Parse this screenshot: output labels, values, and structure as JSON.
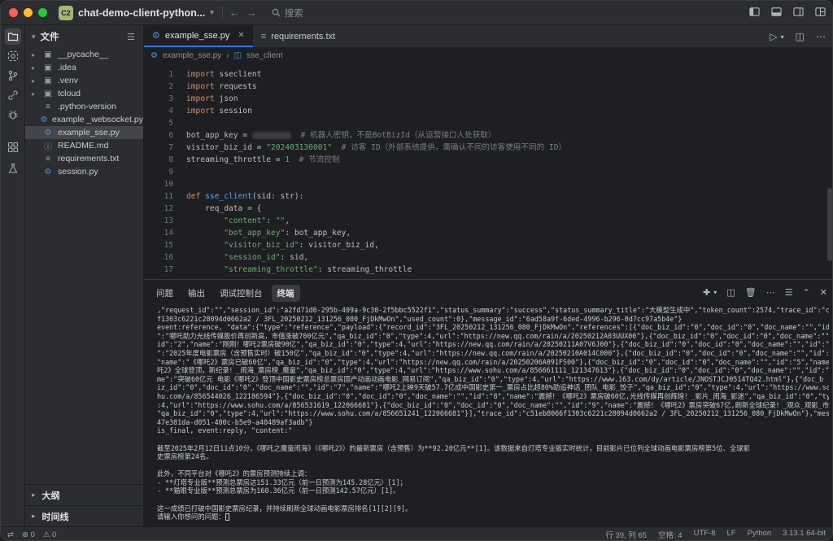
{
  "titlebar": {
    "project_badge": "C2",
    "project_name": "chat-demo-client-python...",
    "search_placeholder": "搜索"
  },
  "explorer": {
    "title": "文件",
    "items": [
      {
        "label": "__pycache__",
        "kind": "folder",
        "icon": "folder-icon"
      },
      {
        "label": ".idea",
        "kind": "folder",
        "icon": "folder-icon"
      },
      {
        "label": ".venv",
        "kind": "folder",
        "icon": "folder-icon"
      },
      {
        "label": "tcloud",
        "kind": "folder",
        "icon": "folder-icon"
      },
      {
        "label": ".python-version",
        "kind": "file",
        "icon": "text-file-icon"
      },
      {
        "label": "example _websocket.py",
        "kind": "file",
        "icon": "python-icon"
      },
      {
        "label": "example_sse.py",
        "kind": "file",
        "icon": "python-icon",
        "selected": true
      },
      {
        "label": "README.md",
        "kind": "file",
        "icon": "info-icon"
      },
      {
        "label": "requirements.txt",
        "kind": "file",
        "icon": "text-file-icon"
      },
      {
        "label": "session.py",
        "kind": "file",
        "icon": "python-icon"
      }
    ],
    "outline": "大纲",
    "timeline": "时间线"
  },
  "tabs": [
    {
      "label": "example_sse.py",
      "active": true
    },
    {
      "label": "requirements.txt",
      "active": false
    }
  ],
  "breadcrumb": {
    "file": "example_sse.py",
    "symbol": "sse_client"
  },
  "code": {
    "line_numbers": [
      "1",
      "2",
      "3",
      "4",
      "5",
      "6",
      "7",
      "8",
      "9",
      "10",
      "11",
      "12",
      "13",
      "14",
      "15",
      "16",
      "17"
    ],
    "l1": [
      "import",
      " sseclient"
    ],
    "l2": [
      "import",
      " requests"
    ],
    "l3": [
      "import",
      " json"
    ],
    "l4": [
      "import",
      " session"
    ],
    "l6": [
      "bot_app_key = ",
      "# 机器人密钥，不是BotBizId（从运营接口人处获取）"
    ],
    "l7": [
      "visitor_biz_id = ",
      "\"202403130001\"",
      "# 访客 ID（外部系统提供，需确认不同的访客使用不同的 ID）"
    ],
    "l8": [
      "streaming_throttle = ",
      "1",
      "# 节流控制"
    ],
    "l11": [
      "def",
      " sse_client",
      "(sid: str):"
    ],
    "l12": [
      "    req_data = {"
    ],
    "l13": [
      "        ",
      "\"content\"",
      ": ",
      "\"\"",
      ","
    ],
    "l14": [
      "        ",
      "\"bot_app_key\"",
      ": bot_app_key,"
    ],
    "l15": [
      "        ",
      "\"visitor_biz_id\"",
      ": visitor_biz_id,"
    ],
    "l16": [
      "        ",
      "\"session_id\"",
      ": sid,"
    ],
    "l17": [
      "        ",
      "\"streaming_throttle\"",
      ": streaming_throttle"
    ]
  },
  "panel": {
    "tabs": [
      "问题",
      "输出",
      "调试控制台",
      "终端"
    ],
    "active_tab": "终端"
  },
  "terminal": {
    "lines": [
      ",\"request_id\":\"\",\"session_id\":\"a2fd71d6-295b-409a-9c30-2f5bbc5522f1\",\"status_summary\":\"success\",\"status_summary_title\":\"大模型生成中\",\"token_count\":2574,\"trace_id\":\"c51eb8066",
      "f1303c6221c28094d0662a2 / 3FL_20250212_131256_080_FjDkMwOn\",\"used_count\":0},\"message_id\":\"6ad58a9f-6ded-4996-b296-0d7cc97a5b4e\"}",
      "event:reference, \"data\":{\"type\":\"reference\",\"payload\":{\"record_id\":\"3FL_20250212_131256_080_FjDkMwOn\",\"references\":[{\"doc_biz_id\":\"0\",\"doc_id\":\"0\",\"doc_name\":\"\",\"id\":\"1\",\"name",
      "\":\"哪吒助力光线传媒股价再创新高，市值涨破700亿元\",\"qa_biz_id\":\"0\",\"type\":4,\"url\":\"https://new.qq.com/rain/a/20250212A03UUX00\"},{\"doc_biz_id\":\"0\",\"doc_id\":\"0\",\"doc_name\":\"\",\"",
      "id\":\"2\",\"name\":\"刚刚！哪吒2票房破90亿\",\"qa_biz_id\":\"0\",\"type\":4,\"url\":\"https://new.qq.com/rain/a/20250211A07V6J00\"},{\"doc_biz_id\":\"0\",\"doc_id\":\"0\",\"doc_name\":\"\",\"id\":\"3\",\"name",
      "\":\"2025年度电影票房（含预售实时）破150亿\",\"qa_biz_id\":\"0\",\"type\":4,\"url\":\"https://new.qq.com/rain/a/20250210A014C000\"},{\"doc_biz_id\":\"0\",\"doc_id\":\"0\",\"doc_name\":\"\",\"id\":\"4\",",
      "\"name\":\"《哪吒2》票房已破60亿\",\"qa_biz_id\":\"0\",\"type\":4,\"url\":\"https://new.qq.com/rain/a/20250206A091FS00\"},{\"doc_biz_id\":\"0\",\"doc_id\":\"0\",\"doc_name\":\"\",\"id\":\"5\",\"name\":\"《哪",
      "吒2》全球登顶，新纪录！_闹海_票房榜_魔童\",\"qa_biz_id\":\"0\",\"type\":4,\"url\":\"https://www.sohu.com/a/856661111_121347613\"},{\"doc_biz_id\":\"0\",\"doc_id\":\"0\",\"doc_name\":\"\",\"id\":\"6\",\"na",
      "me\":\"突破60亿元 电影《哪吒2》登顶中国影史票房榜总票房国产动画动画电影_网易订阅\",\"qa_biz_id\":\"0\",\"type\":4,\"url\":\"https://www.163.com/dy/article/JNOSTJCJ0514TQ42.html\"},{\"doc_b",
      "iz_id\":\"0\",\"doc_id\":\"0\",\"doc_name\":\"\",\"id\":\"7\",\"name\":\"哪吒2上映9天破57.7亿成中国影史第一_票房占比超80%助追神话_团队_电影_饺子\",\"qa_biz_id\":\"0\",\"type\":4,\"url\":\"https://www.so",
      "hu.com/a/856544026_122186594\"},{\"doc_biz_id\":\"0\",\"doc_id\":\"0\",\"doc_name\":\"\",\"id\":\"8\",\"name\":\"震撼！《哪吒2》票房破60亿,光线传媒再创辉煌！_影片_闹海_影迷\",\"qa_biz_id\":\"0\",\"type\"",
      ":4,\"url\":\"https://www.sohu.com/a/856531619_122066681\"},{\"doc_biz_id\":\"0\",\"doc_id\":\"0\",\"doc_name\":\"\",\"id\":\"9\",\"name\":\"震撼！《哪吒2》票房突破67亿,刷新全球纪录！_观众_观影_市场\",",
      "\"qa_biz_id\":\"0\",\"type\":4,\"url\":\"https://www.sohu.com/a/856651241_122066681\"}],\"trace_id\":\"c51eb8066f1303c6221c28094d0662a2 / 3FL_20250212_131256_080_FjDkMwOn\"},\"message_id\":\"",
      "47e381da-d051-400c-b5e9-a40489af3adb\"}",
      "is_final, event:reply, \"content:\"",
      "",
      "截至2025年2月12日11点10分，《哪吒之魔童闹海》（《哪吒2》）的最新票房（含预售）为**92.20亿元**[1]。该数据来自灯塔专业版实时统计，目前影片已位列全球动画电影票房榜第5位、全球影",
      "史票房榜第24名。",
      "",
      "此外，不同平台对《哪吒2》的票房预测持续上调：",
      "- **灯塔专业版**预测总票房达151.33亿元（前一日预测为145.28亿元）[1]；",
      "- **猫眼专业版**预测总票房为160.36亿元（前一日预测142.57亿元）[1]。",
      "",
      "这一成绩已打破中国影史票房纪录，并持续刷新全球动画电影票房排名[1][2][9]。",
      "请输入你想问的问题："
    ]
  },
  "statusbar": {
    "position": "行 39, 列 65",
    "indent": "空格: 4",
    "encoding": "UTF-8",
    "eol": "LF",
    "language": "Python",
    "interpreter": "3.13.1 64-bit"
  },
  "colors": {
    "background": "#1e1f22",
    "chrome": "#2b2d30",
    "accent": "#3574f0",
    "keyword": "#cf8e6d",
    "function": "#56a8f5",
    "string": "#6aab73",
    "number": "#2aacb8",
    "comment": "#7a7e85"
  }
}
